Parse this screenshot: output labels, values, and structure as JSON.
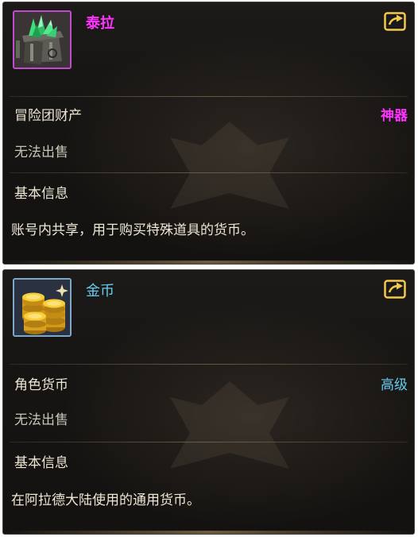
{
  "items": [
    {
      "name": "泰拉",
      "category": "冒险团财产",
      "rarity": "神器",
      "sell_status": "无法出售",
      "info_header": "基本信息",
      "description": "账号内共享，用于购买特殊道具的货币。",
      "icon": "green-crystal-chest-icon",
      "colors": {
        "name": "#ff33ff",
        "rarity": "#ff33ff",
        "frame": "#c24ad0"
      }
    },
    {
      "name": "金币",
      "category": "角色货币",
      "rarity": "高级",
      "sell_status": "无法出售",
      "info_header": "基本信息",
      "description": "在阿拉德大陆使用的通用货币。",
      "icon": "gold-coins-icon",
      "colors": {
        "name": "#66ccee",
        "rarity": "#66ccee",
        "frame": "#7fa8c8"
      }
    }
  ],
  "share_icon": "share-icon"
}
